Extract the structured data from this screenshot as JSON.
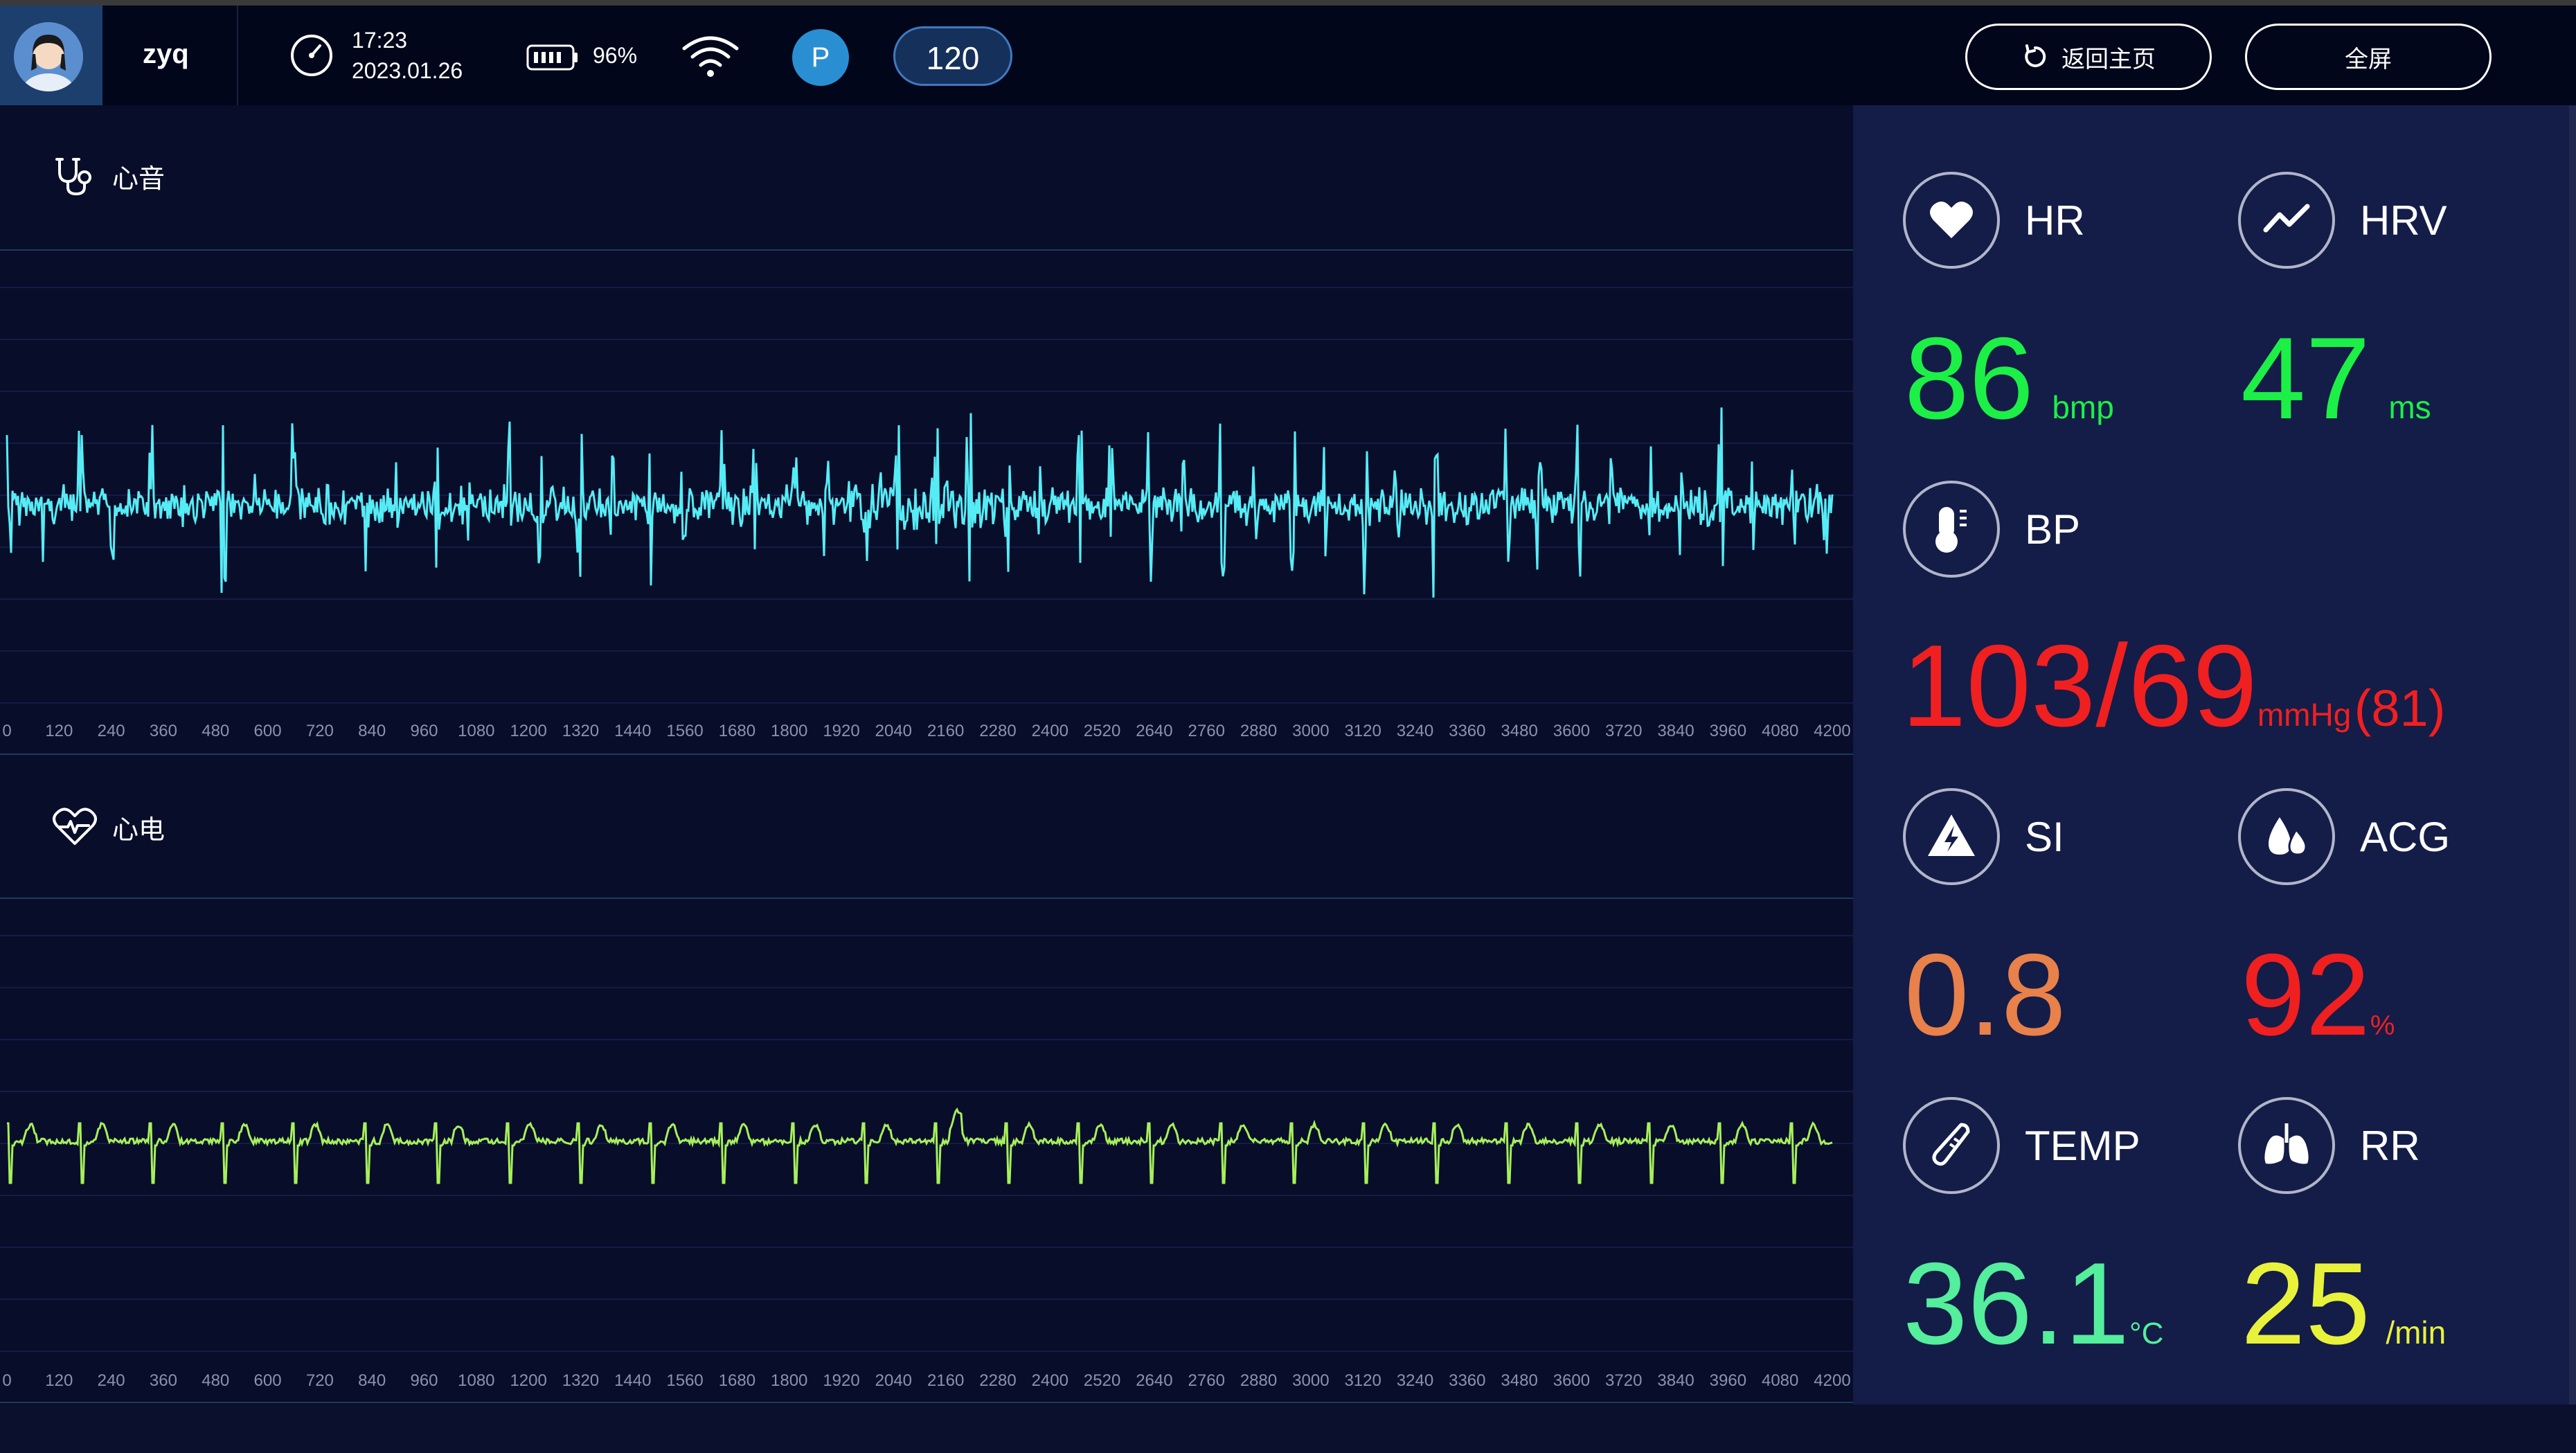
{
  "header": {
    "username": "zyq",
    "time": "17:23",
    "date": "2023.01.26",
    "battery": "96%",
    "badge_letter": "P",
    "counter": "120",
    "home_button": "返回主页",
    "fullscreen_button": "全屏"
  },
  "heart_sound": {
    "title": "心音",
    "ticks": [
      "0",
      "120",
      "240",
      "360",
      "480",
      "600",
      "720",
      "840",
      "960",
      "1080",
      "1200",
      "1320",
      "1440",
      "1560",
      "1680",
      "1800",
      "1920",
      "2040",
      "2160",
      "2280",
      "2400",
      "2520",
      "2640",
      "2760",
      "2880",
      "3000",
      "3120",
      "3240",
      "3360",
      "3480",
      "3600",
      "3720",
      "3840",
      "3960",
      "4080",
      "4200"
    ],
    "color": "#56ecf5"
  },
  "ecg": {
    "title": "心电",
    "ticks": [
      "0",
      "120",
      "240",
      "360",
      "480",
      "600",
      "720",
      "840",
      "960",
      "1080",
      "1200",
      "1320",
      "1440",
      "1560",
      "1680",
      "1800",
      "1920",
      "2040",
      "2160",
      "2280",
      "2400",
      "2520",
      "2640",
      "2760",
      "2880",
      "3000",
      "3120",
      "3240",
      "3360",
      "3480",
      "3600",
      "3720",
      "3840",
      "3960",
      "4080",
      "4200"
    ],
    "color": "#a6f05a"
  },
  "metrics": {
    "hr": {
      "label": "HR",
      "value": "86",
      "unit": "bmp",
      "color": "#1cf046",
      "icon": "heart-icon"
    },
    "hrv": {
      "label": "HRV",
      "value": "47",
      "unit": "ms",
      "color": "#1cf046",
      "icon": "trend-icon"
    },
    "bp": {
      "label": "BP",
      "value": "103/69",
      "unit": "mmHg",
      "extra": "(81)",
      "color": "#f02020",
      "icon": "thermometer-bp-icon"
    },
    "si": {
      "label": "SI",
      "value": "0.8",
      "color": "#e8814a",
      "icon": "warning-bolt-icon"
    },
    "acg": {
      "label": "ACG",
      "value": "92",
      "unit": "%",
      "color": "#f02020",
      "icon": "drops-icon"
    },
    "temp": {
      "label": "TEMP",
      "value": "36.1",
      "unit": "°C",
      "color": "#54ee9c",
      "icon": "thermometer-icon"
    },
    "rr": {
      "label": "RR",
      "value": "25",
      "unit": "/min",
      "color": "#e8f23a",
      "icon": "lungs-icon"
    }
  }
}
